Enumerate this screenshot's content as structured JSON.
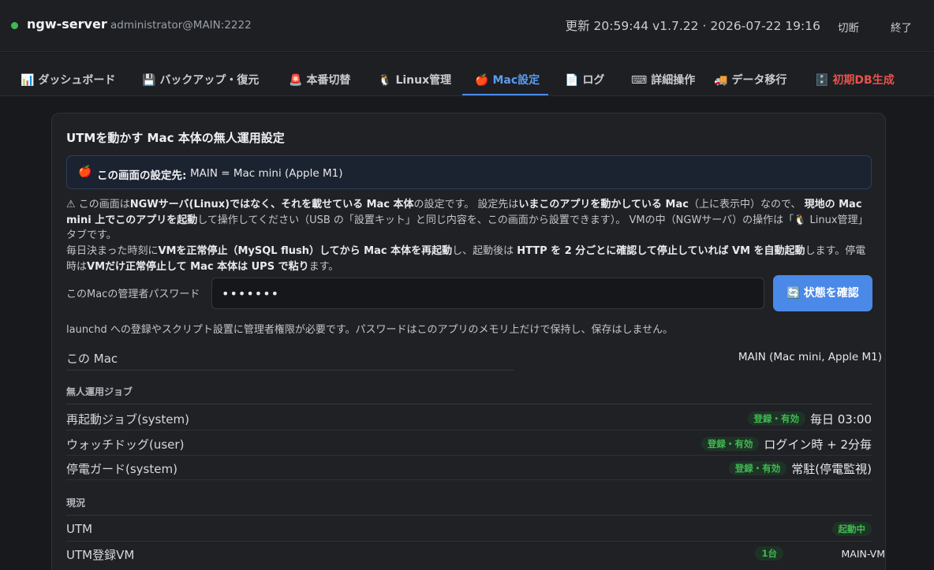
{
  "header": {
    "app_name": "ngw-server",
    "account": "administrator@MAIN:2222",
    "updated": "更新 20:59:44 v1.7.22 · 2026-07-22 19:16",
    "cut_label": "切断",
    "quit_label": "終了",
    "status_color": "#3fb950"
  },
  "tabs": [
    {
      "icon": "📊",
      "icon_name": "chart-icon",
      "label": "ダッシュボード"
    },
    {
      "icon": "💾",
      "icon_name": "floppy-icon",
      "label": "バックアップ・復元"
    },
    {
      "icon": "🚨",
      "icon_name": "siren-icon",
      "label": "本番切替"
    },
    {
      "icon": "🐧",
      "icon_name": "penguin-icon",
      "label": "Linux管理"
    },
    {
      "icon": "🍎",
      "icon_name": "apple-icon",
      "label": "Mac設定",
      "active": true
    },
    {
      "icon": "📄",
      "icon_name": "document-icon",
      "label": "ログ"
    },
    {
      "icon": "⌨",
      "icon_name": "keyboard-icon",
      "label": "詳細操作"
    },
    {
      "icon": "🚚",
      "icon_name": "truck-icon",
      "label": "データ移行"
    },
    {
      "icon": "🗄️",
      "icon_name": "cabinet-icon",
      "label": "初期DB生成",
      "danger": true
    }
  ],
  "card": {
    "title": "UTMを動かす Mac 本体の無人運用設定",
    "target_label": "この画面の設定先:",
    "target_value": "MAIN = Mac mini (Apple M1)",
    "password_label": "このMacの管理者パスワード",
    "password_value": "•••••••",
    "check_button": "状態を確認",
    "permission_note": "launchd への登録やスクリプト設置に管理者権限が必要です。パスワードはこのアプリのメモリ上だけで保持し、保存はしません。",
    "this_mac_label": "この Mac",
    "this_mac_value": "MAIN (Mac mini, Apple M1)"
  },
  "jobs": {
    "heading": "無人運用ジョブ",
    "items": [
      {
        "label": "再起動ジョブ(system)",
        "badge": "登録・有効",
        "value": "毎日 03:00"
      },
      {
        "label": "ウォッチドッグ(user)",
        "badge": "登録・有効",
        "value": "ログイン時 + 2分毎"
      },
      {
        "label": "停電ガード(system)",
        "badge": "登録・有効",
        "value": "常駐(停電監視)"
      }
    ]
  },
  "status": {
    "heading": "現況",
    "utm_label": "UTM",
    "utm_badge": "起動中",
    "vm_label": "UTM登録VM",
    "vm_badge": "1台",
    "vm_name": "MAIN-VM"
  },
  "accent_color": "#4a89e8",
  "danger_color": "#e5534b",
  "success_color": "#3fb950"
}
